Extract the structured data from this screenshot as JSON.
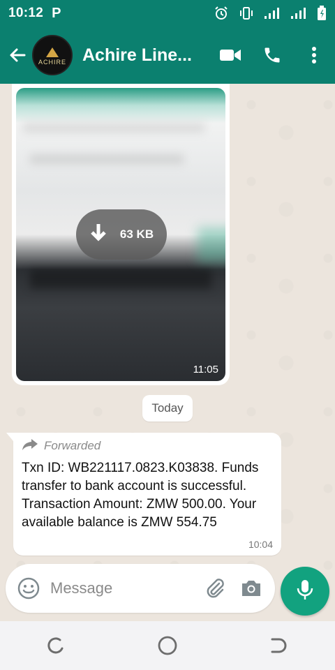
{
  "status_bar": {
    "time": "10:12",
    "p_indicator": "P",
    "icons": [
      "alarm-icon",
      "vibrate-icon",
      "signal-icon",
      "signal-icon",
      "battery-icon"
    ]
  },
  "header": {
    "contact_name": "Achire Line...",
    "avatar_text": "ACHIRE",
    "icons": [
      "back-arrow-icon",
      "video-call-icon",
      "phone-icon",
      "more-vert-icon"
    ]
  },
  "messages": {
    "image": {
      "download_size": "63 KB",
      "time": "11:05"
    },
    "date_separator": "Today",
    "text": {
      "forwarded_label": "Forwarded",
      "body": "Txn ID: WB221117.0823.K03838. Funds transfer to bank account is successful. Transaction Amount: ZMW 500.00. Your available balance is ZMW 554.75",
      "time": "10:04"
    }
  },
  "composer": {
    "placeholder": "Message",
    "value": "",
    "icons": [
      "emoji-icon",
      "attach-icon",
      "camera-icon",
      "mic-icon"
    ]
  },
  "nav": {
    "icons": [
      "recents-icon",
      "home-icon",
      "back-icon"
    ]
  },
  "colors": {
    "header": "#0b806f",
    "accent": "#12a27f",
    "chat_bg": "#ece5dd"
  }
}
